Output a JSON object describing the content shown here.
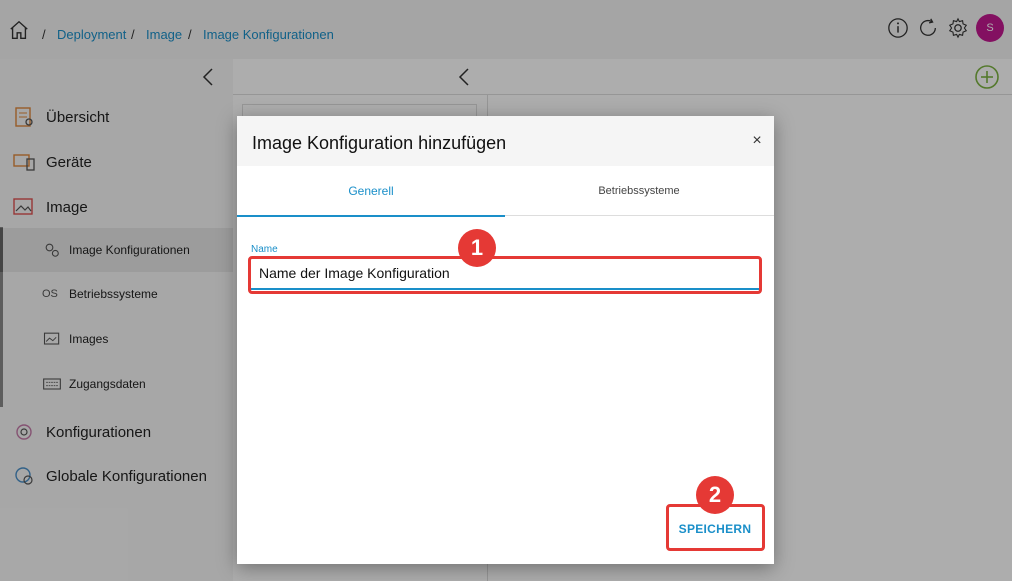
{
  "breadcrumb": {
    "items": [
      "Deployment",
      "Image",
      "Image Konfigurationen"
    ],
    "separator": "/"
  },
  "topbar": {
    "icons": [
      "info-icon",
      "refresh-icon",
      "gear-icon"
    ],
    "avatar_initial": "S",
    "avatar_color": "#c2188f"
  },
  "sidebar": {
    "items": [
      {
        "label": "Übersicht",
        "icon": "overview-icon"
      },
      {
        "label": "Geräte",
        "icon": "devices-icon"
      },
      {
        "label": "Image",
        "icon": "image-icon"
      }
    ],
    "sub_items": [
      {
        "label": "Image Konfigurationen",
        "icon": "gears-icon",
        "active": true
      },
      {
        "label": "Betriebssysteme",
        "icon": "os-icon",
        "icon_text": "OS"
      },
      {
        "label": "Images",
        "icon": "picture-icon"
      },
      {
        "label": "Zugangsdaten",
        "icon": "keyboard-icon"
      }
    ],
    "bottom_items": [
      {
        "label": "Konfigurationen",
        "icon": "config-gear-icon"
      },
      {
        "label": "Globale Konfigurationen",
        "icon": "global-config-icon"
      }
    ]
  },
  "dialog": {
    "title": "Image Konfiguration hinzufügen",
    "close": "×",
    "tabs": [
      "Generell",
      "Betriebssysteme"
    ],
    "field_label": "Name",
    "field_value": "Name der Image Konfiguration",
    "save_label": "SPEICHERN"
  },
  "annotations": {
    "one": "1",
    "two": "2",
    "color": "#e53935"
  },
  "colors": {
    "accent": "#1a8fc9",
    "add_button": "#7cb342"
  }
}
